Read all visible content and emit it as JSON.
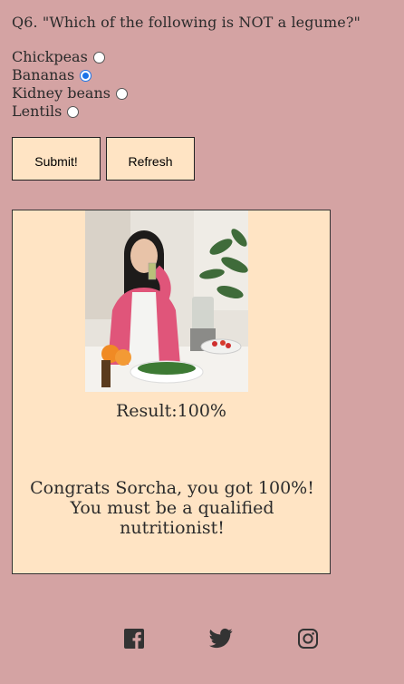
{
  "quiz": {
    "question": "Q6. \"Which of the following is NOT a legume?\"",
    "options": [
      {
        "label": "Chickpeas",
        "selected": false
      },
      {
        "label": "Bananas",
        "selected": true
      },
      {
        "label": "Kidney beans",
        "selected": false
      },
      {
        "label": "Lentils",
        "selected": false
      }
    ],
    "submit_label": "Submit!",
    "refresh_label": "Refresh"
  },
  "result": {
    "score_text": "Result:100%",
    "message": "Congrats Sorcha, you got 100%! You must be a qualified nutritionist!"
  },
  "footer": {
    "icons": [
      "facebook-icon",
      "twitter-icon",
      "instagram-icon"
    ]
  },
  "colors": {
    "background": "#d4a3a3",
    "card": "#ffe4c4",
    "radio_selected": "#1a73e8"
  }
}
